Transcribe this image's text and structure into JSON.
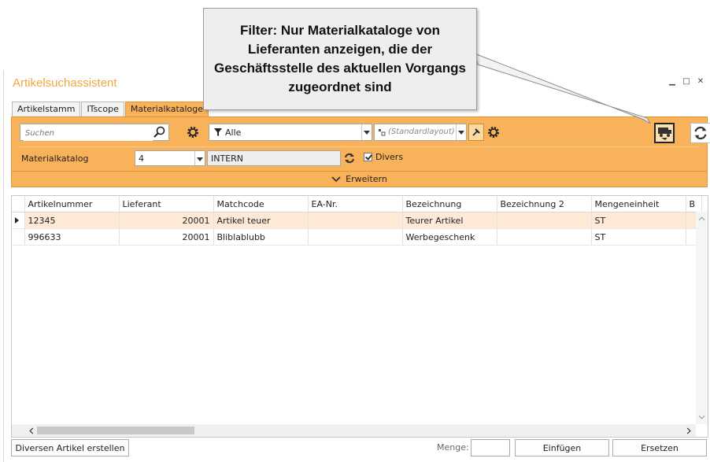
{
  "callout": {
    "text": "Filter: Nur Materialkataloge von Lieferanten anzeigen, die der Geschäftsstelle des aktuellen Vorgangs zugeordnet sind"
  },
  "window": {
    "title": "Artikelsuchassistent",
    "controls": [
      "minimize",
      "maximize",
      "close"
    ]
  },
  "tabs": [
    {
      "label": "Artikelstamm",
      "active": false
    },
    {
      "label": "ITscope",
      "active": false
    },
    {
      "label": "Materialkataloge",
      "active": true
    }
  ],
  "toolbar": {
    "search_placeholder": "Suchen",
    "filter_value": "Alle",
    "layout_value": "(Standardlayout)",
    "material_label": "Materialkatalog",
    "material_number": "4",
    "material_name": "INTERN",
    "divers_label": "Divers",
    "divers_checked": true,
    "expand_label": "Erweitern"
  },
  "grid": {
    "columns": [
      "Artikelnummer",
      "Lieferant",
      "Matchcode",
      "EA-Nr.",
      "Bezeichnung",
      "Bezeichnung 2",
      "Mengeneinheit",
      "B"
    ],
    "rows": [
      {
        "artikelnummer": "12345",
        "lieferant": "20001",
        "matchcode": "Artikel teuer",
        "ea": "",
        "bezeichnung": "Teurer Artikel",
        "bezeichnung2": "",
        "einheit": "ST",
        "selected": true
      },
      {
        "artikelnummer": "996633",
        "lieferant": "20001",
        "matchcode": "Bliblablubb",
        "ea": "",
        "bezeichnung": "Werbegeschenk",
        "bezeichnung2": "",
        "einheit": "ST",
        "selected": false
      }
    ]
  },
  "footer": {
    "divers_button": "Diversen Artikel erstellen",
    "menge_label": "Menge:",
    "menge_value": "",
    "insert_button": "Einfügen",
    "replace_button": "Ersetzen"
  },
  "colors": {
    "accent": "#f8b25a",
    "title": "#f0a840",
    "selected_row": "#fde9d6"
  }
}
